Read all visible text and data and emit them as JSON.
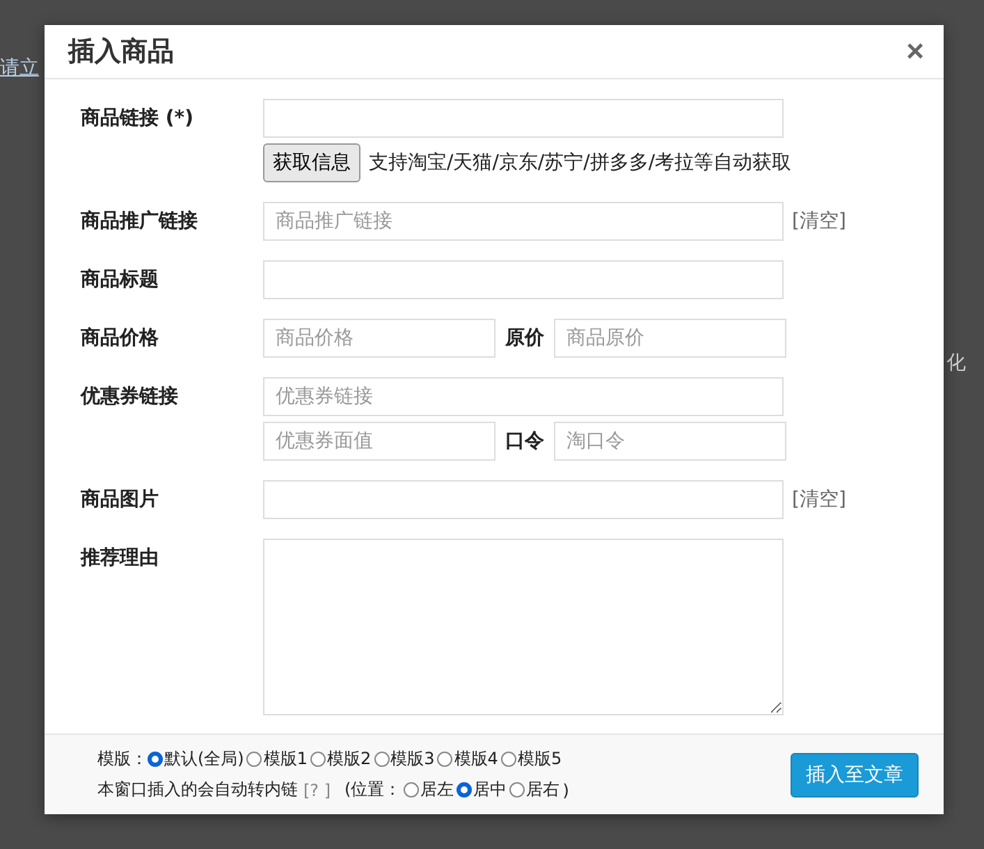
{
  "background": {
    "texts": [
      "请立",
      "化"
    ]
  },
  "dialog": {
    "title": "插入商品",
    "close": "×"
  },
  "fields": [
    {
      "kind": "link",
      "label": "商品链接 (*)",
      "button": "获取信息",
      "hint": "支持淘宝/天猫/京东/苏宁/拼多多/考拉等自动获取"
    },
    {
      "kind": "clear",
      "label": "商品推广链接",
      "input": {
        "placeholder": "商品推广链接"
      },
      "action": "[清空]"
    },
    {
      "kind": "text",
      "label": "商品标题"
    },
    {
      "kind": "pair",
      "label": "商品价格",
      "input": {
        "placeholder": "商品价格"
      },
      "label2": "原价",
      "input2": {
        "placeholder": "商品原价"
      }
    },
    {
      "kind": "coupon",
      "label": "优惠券链接",
      "input": {
        "placeholder": "优惠券链接"
      },
      "input3": {
        "placeholder": "优惠券面值"
      },
      "label2": "口令",
      "input2": {
        "placeholder": "淘口令"
      }
    },
    {
      "kind": "clear",
      "label": "商品图片",
      "action": "[清空]"
    },
    {
      "kind": "textarea",
      "label": "推荐理由"
    }
  ],
  "footer": {
    "template_label": "模版：",
    "templates": [
      {
        "label": "默认(全局)",
        "selected": true
      },
      {
        "label": "模版1",
        "selected": false
      },
      {
        "label": "模版2",
        "selected": false
      },
      {
        "label": "模版3",
        "selected": false
      },
      {
        "label": "模版4",
        "selected": false
      },
      {
        "label": "模版5",
        "selected": false
      }
    ],
    "note": "本窗口插入的会自动转内链",
    "help": "[? ]",
    "position_label": "(位置：",
    "positions": [
      {
        "label": "居左",
        "selected": false
      },
      {
        "label": "居中",
        "selected": true
      },
      {
        "label": "居右",
        "selected": false
      }
    ],
    "position_end": ")",
    "submit": "插入至文章"
  }
}
